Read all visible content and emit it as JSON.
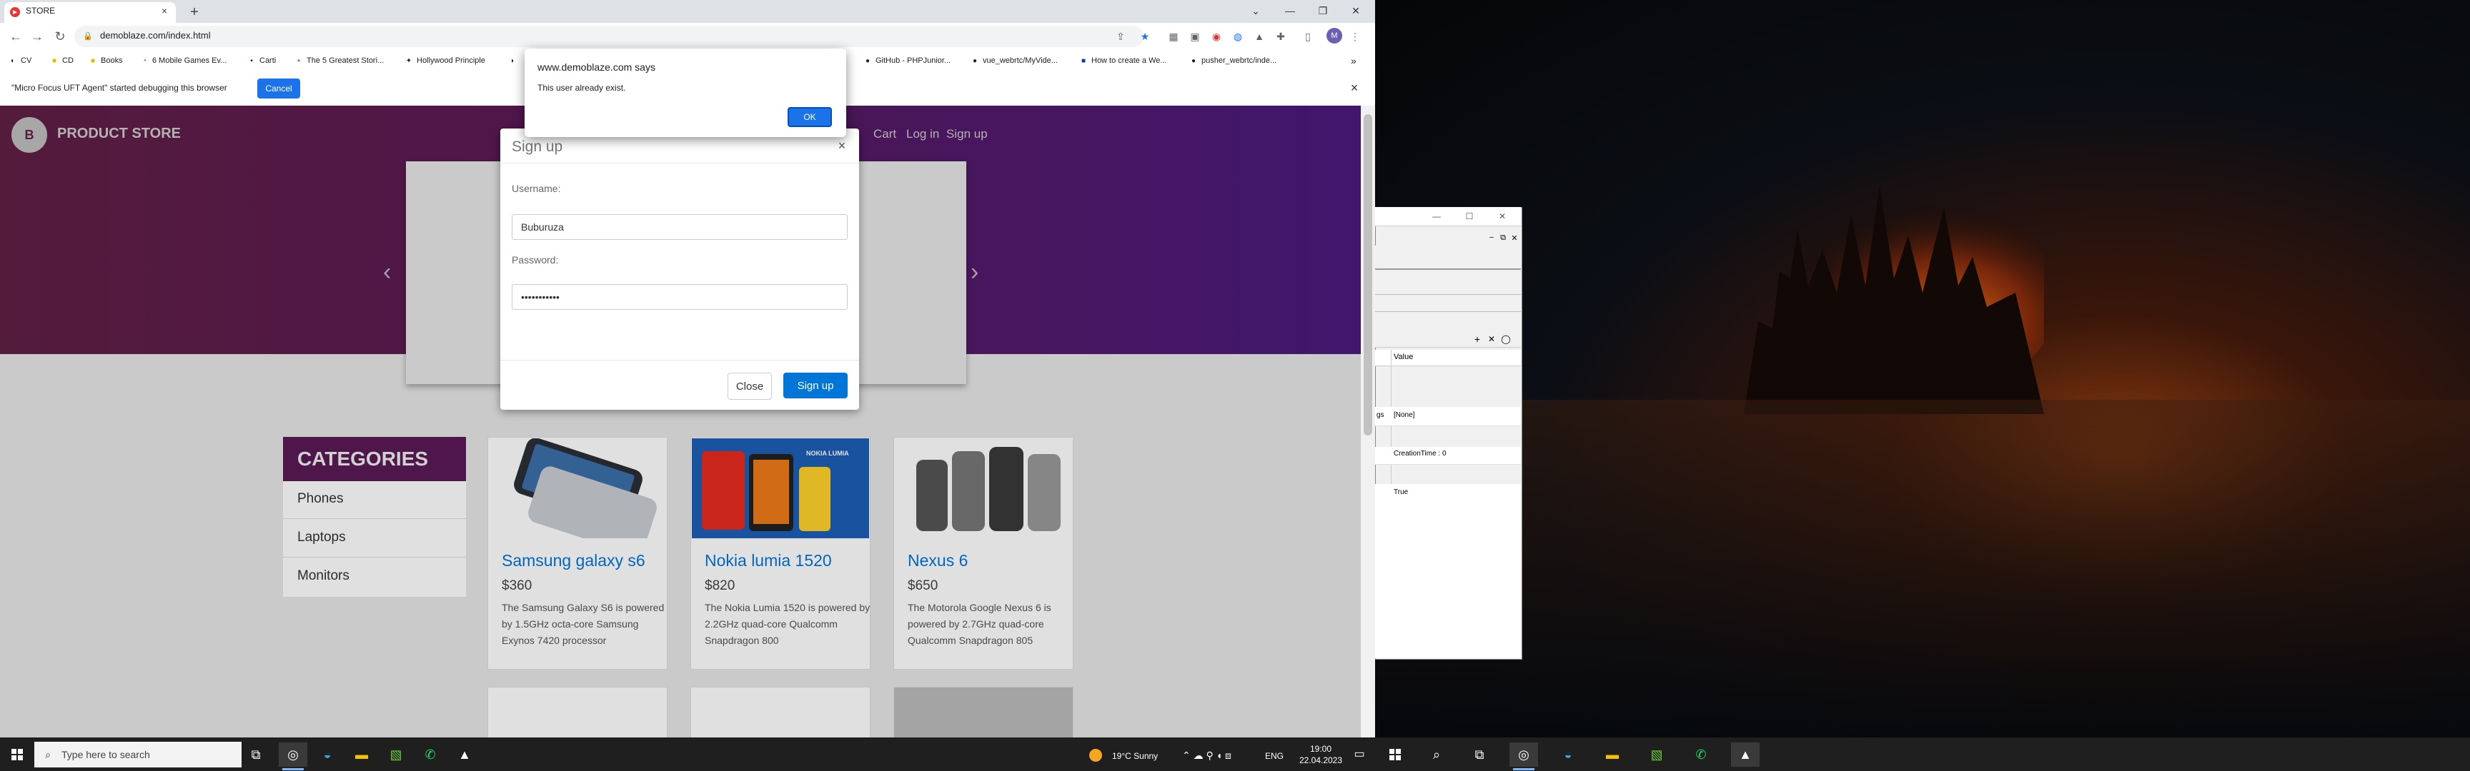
{
  "browser": {
    "tab_title": "STORE",
    "new_tab": "+",
    "url": "demoblaze.com/index.html",
    "window_controls": [
      "⌄",
      "—",
      "❐",
      "✕"
    ],
    "bookmarks": [
      "CV",
      "CD",
      "Books",
      "6 Mobile Games Ev...",
      "Carti",
      "The 5 Greatest Stori...",
      "Hollywood Principle",
      "GitHub - PHPJunior...",
      "vue_webrtc/MyVide...",
      "How to create a We...",
      "pusher_webrtc/inde..."
    ],
    "bookmarks_more": "»",
    "avatar_letter": "M"
  },
  "debug_bar": {
    "message": "\"Micro Focus UFT Agent\" started debugging this browser",
    "cancel_label": "Cancel"
  },
  "alert": {
    "origin": "www.demoblaze.com says",
    "message": "This user already exist.",
    "ok_label": "OK"
  },
  "site": {
    "logo_text": "B",
    "brand": "PRODUCT STORE",
    "nav": [
      "Cart",
      "Log in",
      "Sign up"
    ],
    "categories_title": "CATEGORIES",
    "categories": [
      "Phones",
      "Laptops",
      "Monitors"
    ],
    "products": [
      {
        "title": "Samsung galaxy s6",
        "price": "$360",
        "desc": "The Samsung Galaxy S6 is powered by 1.5GHz octa-core Samsung Exynos 7420 processor"
      },
      {
        "title": "Nokia lumia 1520",
        "price": "$820",
        "desc": "The Nokia Lumia 1520 is powered by 2.2GHz quad-core Qualcomm Snapdragon 800"
      },
      {
        "title": "Nexus 6",
        "price": "$650",
        "desc": "The Motorola Google Nexus 6 is powered by 2.7GHz quad-core Qualcomm Snapdragon 805"
      }
    ],
    "nokia_badge": "NOKIA LUMIA"
  },
  "signup_modal": {
    "title": "Sign up",
    "close_x": "×",
    "username_label": "Username:",
    "username_value": "Buburuza",
    "password_label": "Password:",
    "password_value": "•••••••••••",
    "close_label": "Close",
    "signup_label": "Sign up"
  },
  "taskbar": {
    "search_placeholder": "Type here to search",
    "weather": "19°C  Sunny",
    "language": "ENG",
    "time": "19:00",
    "date": "22.04.2023"
  },
  "side_panel": {
    "column_header": "Value",
    "row_label_partial": "gs",
    "rows": [
      "[None]",
      "CreationTime : 0",
      "True"
    ]
  },
  "colors": {
    "brand_purple": "#5b1a56",
    "link_blue": "#0275d8",
    "chrome_blue": "#1a73e8"
  }
}
